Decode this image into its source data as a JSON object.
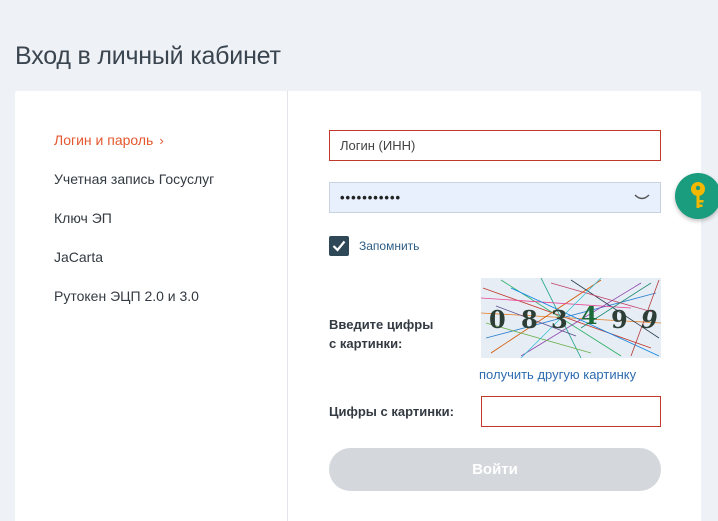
{
  "page": {
    "title": "Вход в личный кабинет"
  },
  "nav": {
    "items": [
      {
        "label": "Логин и пароль",
        "active": true
      },
      {
        "label": "Учетная запись Госуслуг",
        "active": false
      },
      {
        "label": "Ключ ЭП",
        "active": false
      },
      {
        "label": "JaCarta",
        "active": false
      },
      {
        "label": "Рутокен ЭЦП 2.0 и 3.0",
        "active": false
      }
    ],
    "active_chevron": "›"
  },
  "form": {
    "login_placeholder": "Логин (ИНН)",
    "password_value": "•••••••••••",
    "remember_label": "Запомнить",
    "remember_checked": true,
    "captcha_label_line1": "Введите цифры",
    "captcha_label_line2": "с картинки:",
    "captcha_digits": [
      "0",
      "8",
      "3",
      "4",
      "9",
      "9"
    ],
    "captcha_refresh_link": "получить другую картинку",
    "captcha_input_label": "Цифры с картинки:",
    "captcha_input_value": "",
    "submit_label": "Войти"
  },
  "colors": {
    "accent": "#e4572e",
    "key_button": "#1a9c7e",
    "key_icon": "#f5b800",
    "link": "#2d6cb0",
    "error_border": "#c0392b",
    "submit_disabled": "#d4d8dc"
  },
  "icons": {
    "key": "key-icon",
    "eye": "eye-closed-icon",
    "check": "checkmark-icon"
  }
}
